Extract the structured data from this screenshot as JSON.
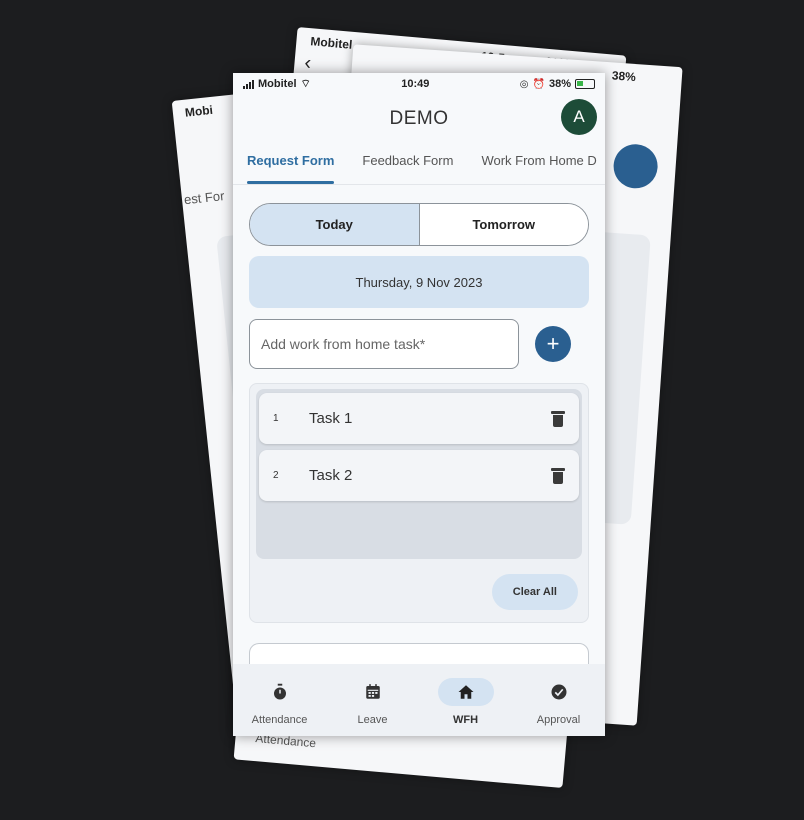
{
  "status_bar": {
    "carrier": "Mobitel",
    "time": "10:49",
    "battery": "38%"
  },
  "background_cards": {
    "left_carrier": "Mobi",
    "left_tab_fragment": "est For",
    "back_carrier": "Mobitel",
    "back_time": "10:5",
    "back_battery": "38%",
    "back_nav_label": "Attendance",
    "right_battery": "38%",
    "right_nav_label": "roval"
  },
  "header": {
    "title": "DEMO",
    "avatar_initial": "A"
  },
  "tabs": [
    {
      "label": "Request Form",
      "active": true
    },
    {
      "label": "Feedback Form",
      "active": false
    },
    {
      "label": "Work From Home D",
      "active": false
    }
  ],
  "day_toggle": {
    "today": "Today",
    "tomorrow": "Tomorrow",
    "selected": "Today"
  },
  "date_banner": "Thursday, 9 Nov 2023",
  "add_task": {
    "placeholder": "Add work from home task*",
    "button_icon": "plus-icon",
    "button_glyph": "+"
  },
  "tasks": [
    {
      "number": "1",
      "name": "Task 1"
    },
    {
      "number": "2",
      "name": "Task 2"
    }
  ],
  "clear_all_label": "Clear All",
  "bottom_nav": [
    {
      "label": "Attendance",
      "icon": "stopwatch-icon",
      "active": false
    },
    {
      "label": "Leave",
      "icon": "calendar-icon",
      "active": false
    },
    {
      "label": "WFH",
      "icon": "home-icon",
      "active": true
    },
    {
      "label": "Approval",
      "icon": "check-circle-icon",
      "active": false
    }
  ],
  "colors": {
    "accent": "#2f6ea1",
    "primary_button": "#2a5f90",
    "selection": "#d4e3f2",
    "avatar": "#1d4c38"
  }
}
